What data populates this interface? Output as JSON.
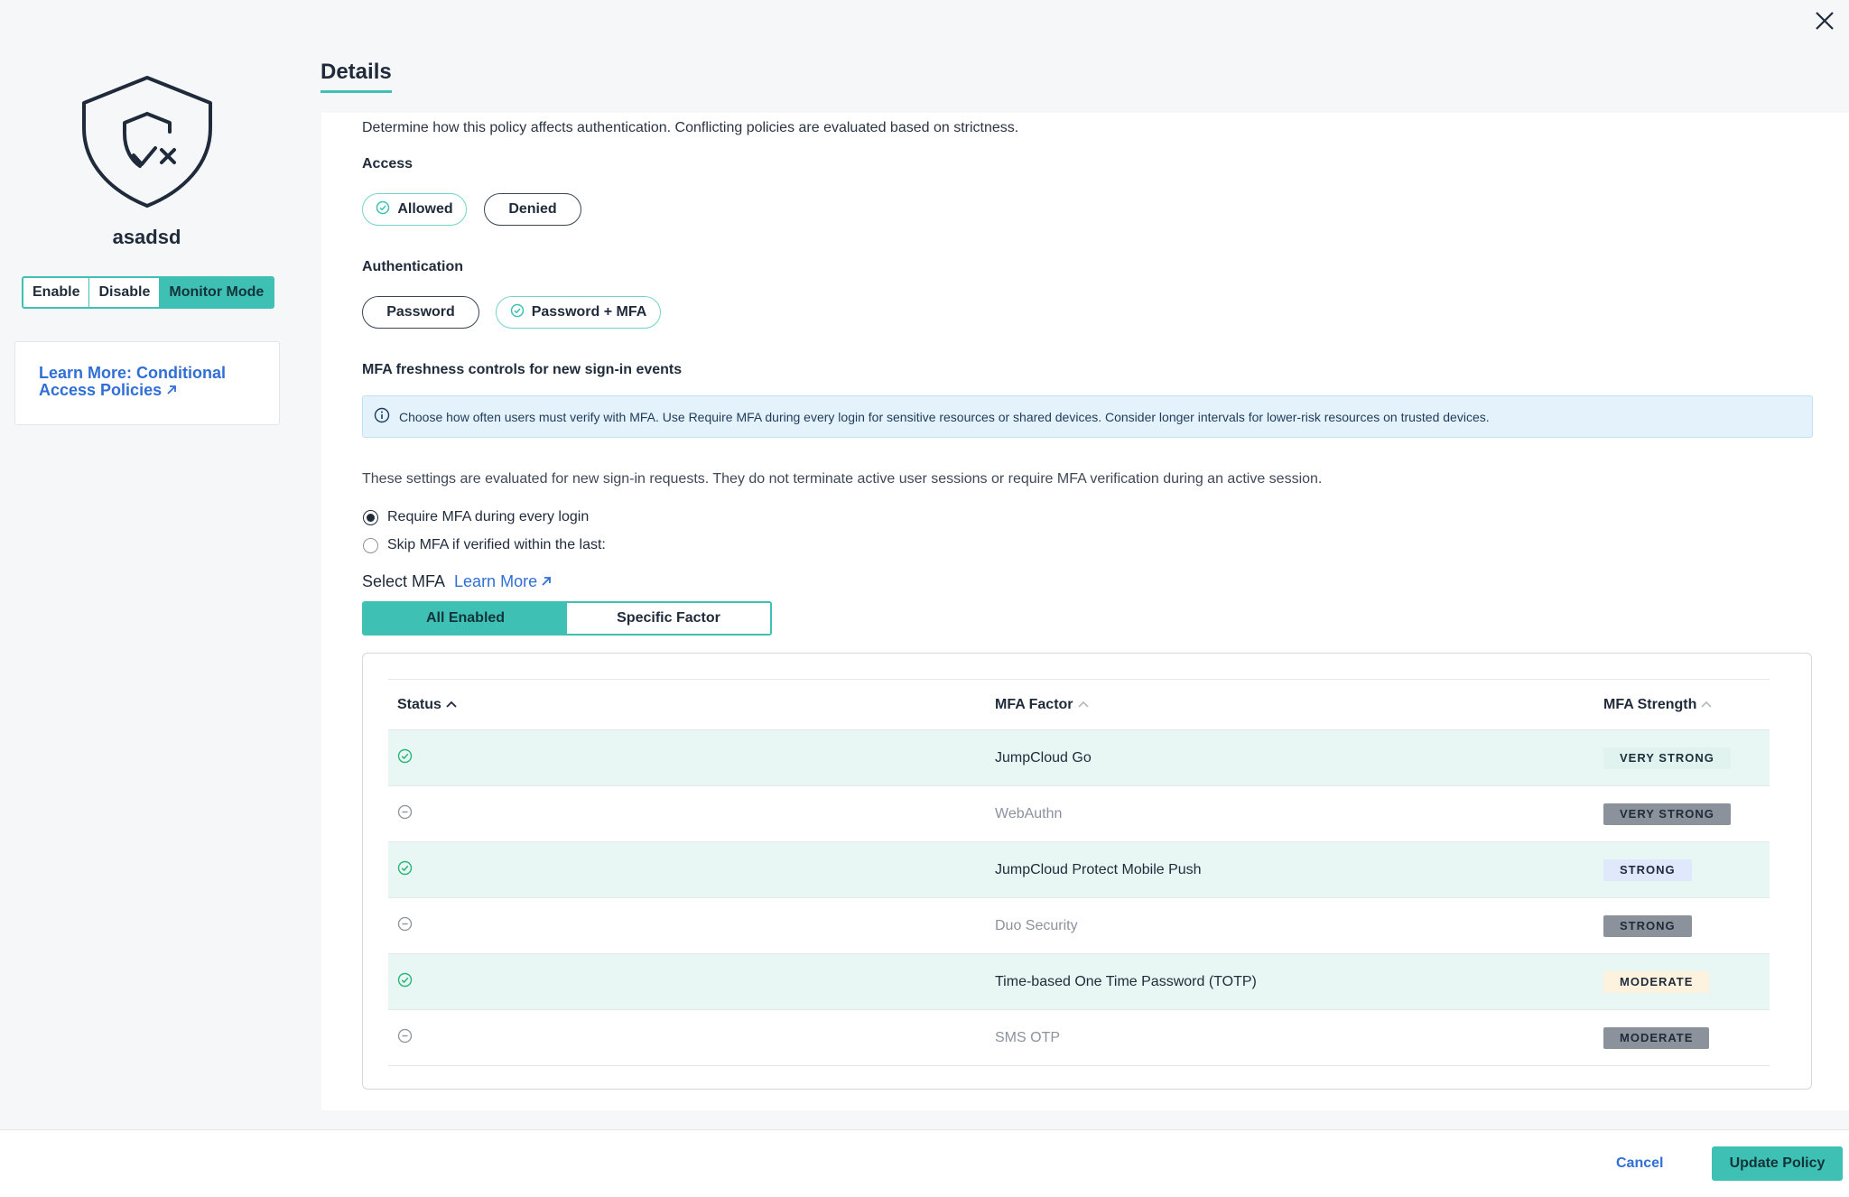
{
  "sidebar": {
    "policy_name": "asadsd",
    "modes": [
      "Enable",
      "Disable",
      "Monitor Mode"
    ],
    "active_mode": "Monitor Mode",
    "learn_more_line1": "Learn More: Conditional",
    "learn_more_line2": "Access Policies"
  },
  "main": {
    "tab_title": "Details",
    "intro": "Determine how this policy affects authentication. Conflicting policies are evaluated based on strictness.",
    "access": {
      "label": "Access",
      "options": [
        "Allowed",
        "Denied"
      ],
      "selected": "Allowed"
    },
    "authentication": {
      "label": "Authentication",
      "options": [
        "Password",
        "Password + MFA"
      ],
      "selected": "Password + MFA"
    },
    "mfa_freshness": {
      "label": "MFA freshness controls for new sign-in events",
      "info": "Choose how often users must verify with MFA. Use Require MFA during every login for sensitive resources or shared devices. Consider longer intervals for lower-risk resources on trusted devices.",
      "note": "These settings are evaluated for new sign-in requests. They do not terminate active user sessions or require MFA verification during an active session.",
      "options": [
        "Require MFA during every login",
        "Skip MFA if verified within the last:"
      ],
      "selected": "Require MFA during every login"
    },
    "select_mfa": {
      "label": "Select MFA",
      "learn_more": "Learn More",
      "toggle": [
        "All Enabled",
        "Specific Factor"
      ],
      "active": "All Enabled"
    },
    "table": {
      "headers": [
        "Status",
        "MFA Factor",
        "MFA Strength"
      ],
      "rows": [
        {
          "enabled": true,
          "factor": "JumpCloud Go",
          "strength": "VERY STRONG"
        },
        {
          "enabled": false,
          "factor": "WebAuthn",
          "strength": "VERY STRONG"
        },
        {
          "enabled": true,
          "factor": "JumpCloud Protect Mobile Push",
          "strength": "STRONG"
        },
        {
          "enabled": false,
          "factor": "Duo Security",
          "strength": "STRONG"
        },
        {
          "enabled": true,
          "factor": "Time-based One Time Password (TOTP)",
          "strength": "MODERATE"
        },
        {
          "enabled": false,
          "factor": "SMS OTP",
          "strength": "MODERATE"
        }
      ]
    }
  },
  "footer": {
    "cancel": "Cancel",
    "update": "Update Policy"
  },
  "colors": {
    "accent": "#3ec1b4",
    "link": "#2f6fd6",
    "enabled_row": "#e8f6f4"
  }
}
